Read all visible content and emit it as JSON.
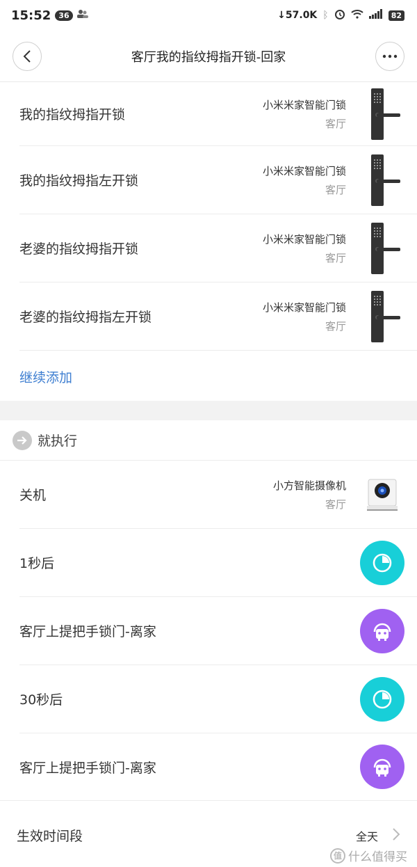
{
  "status_bar": {
    "time": "15:52",
    "notif_count": "36",
    "net_speed": "57.0K",
    "battery": "82"
  },
  "header": {
    "title": "客厅我的指纹拇指开锁-回家"
  },
  "conditions": [
    {
      "label": "我的指纹拇指开锁",
      "device": "小米米家智能门锁",
      "room": "客厅"
    },
    {
      "label": "我的指纹拇指左开锁",
      "device": "小米米家智能门锁",
      "room": "客厅"
    },
    {
      "label": "老婆的指纹拇指开锁",
      "device": "小米米家智能门锁",
      "room": "客厅"
    },
    {
      "label": "老婆的指纹拇指左开锁",
      "device": "小米米家智能门锁",
      "room": "客厅"
    }
  ],
  "add_more_label": "继续添加",
  "actions_header": "就执行",
  "actions": [
    {
      "label": "关机",
      "device": "小方智能摄像机",
      "room": "客厅",
      "kind": "camera"
    },
    {
      "label": "1秒后",
      "kind": "delay"
    },
    {
      "label": "客厅上提把手锁门-离家",
      "kind": "scene"
    },
    {
      "label": "30秒后",
      "kind": "delay"
    },
    {
      "label": "客厅上提把手锁门-离家",
      "kind": "scene"
    }
  ],
  "footer": {
    "label": "生效时间段",
    "value": "全天"
  },
  "watermark": "什么值得买",
  "colors": {
    "link": "#3f7fd1",
    "delay": "#18cfd8",
    "scene": "#a061f1"
  }
}
